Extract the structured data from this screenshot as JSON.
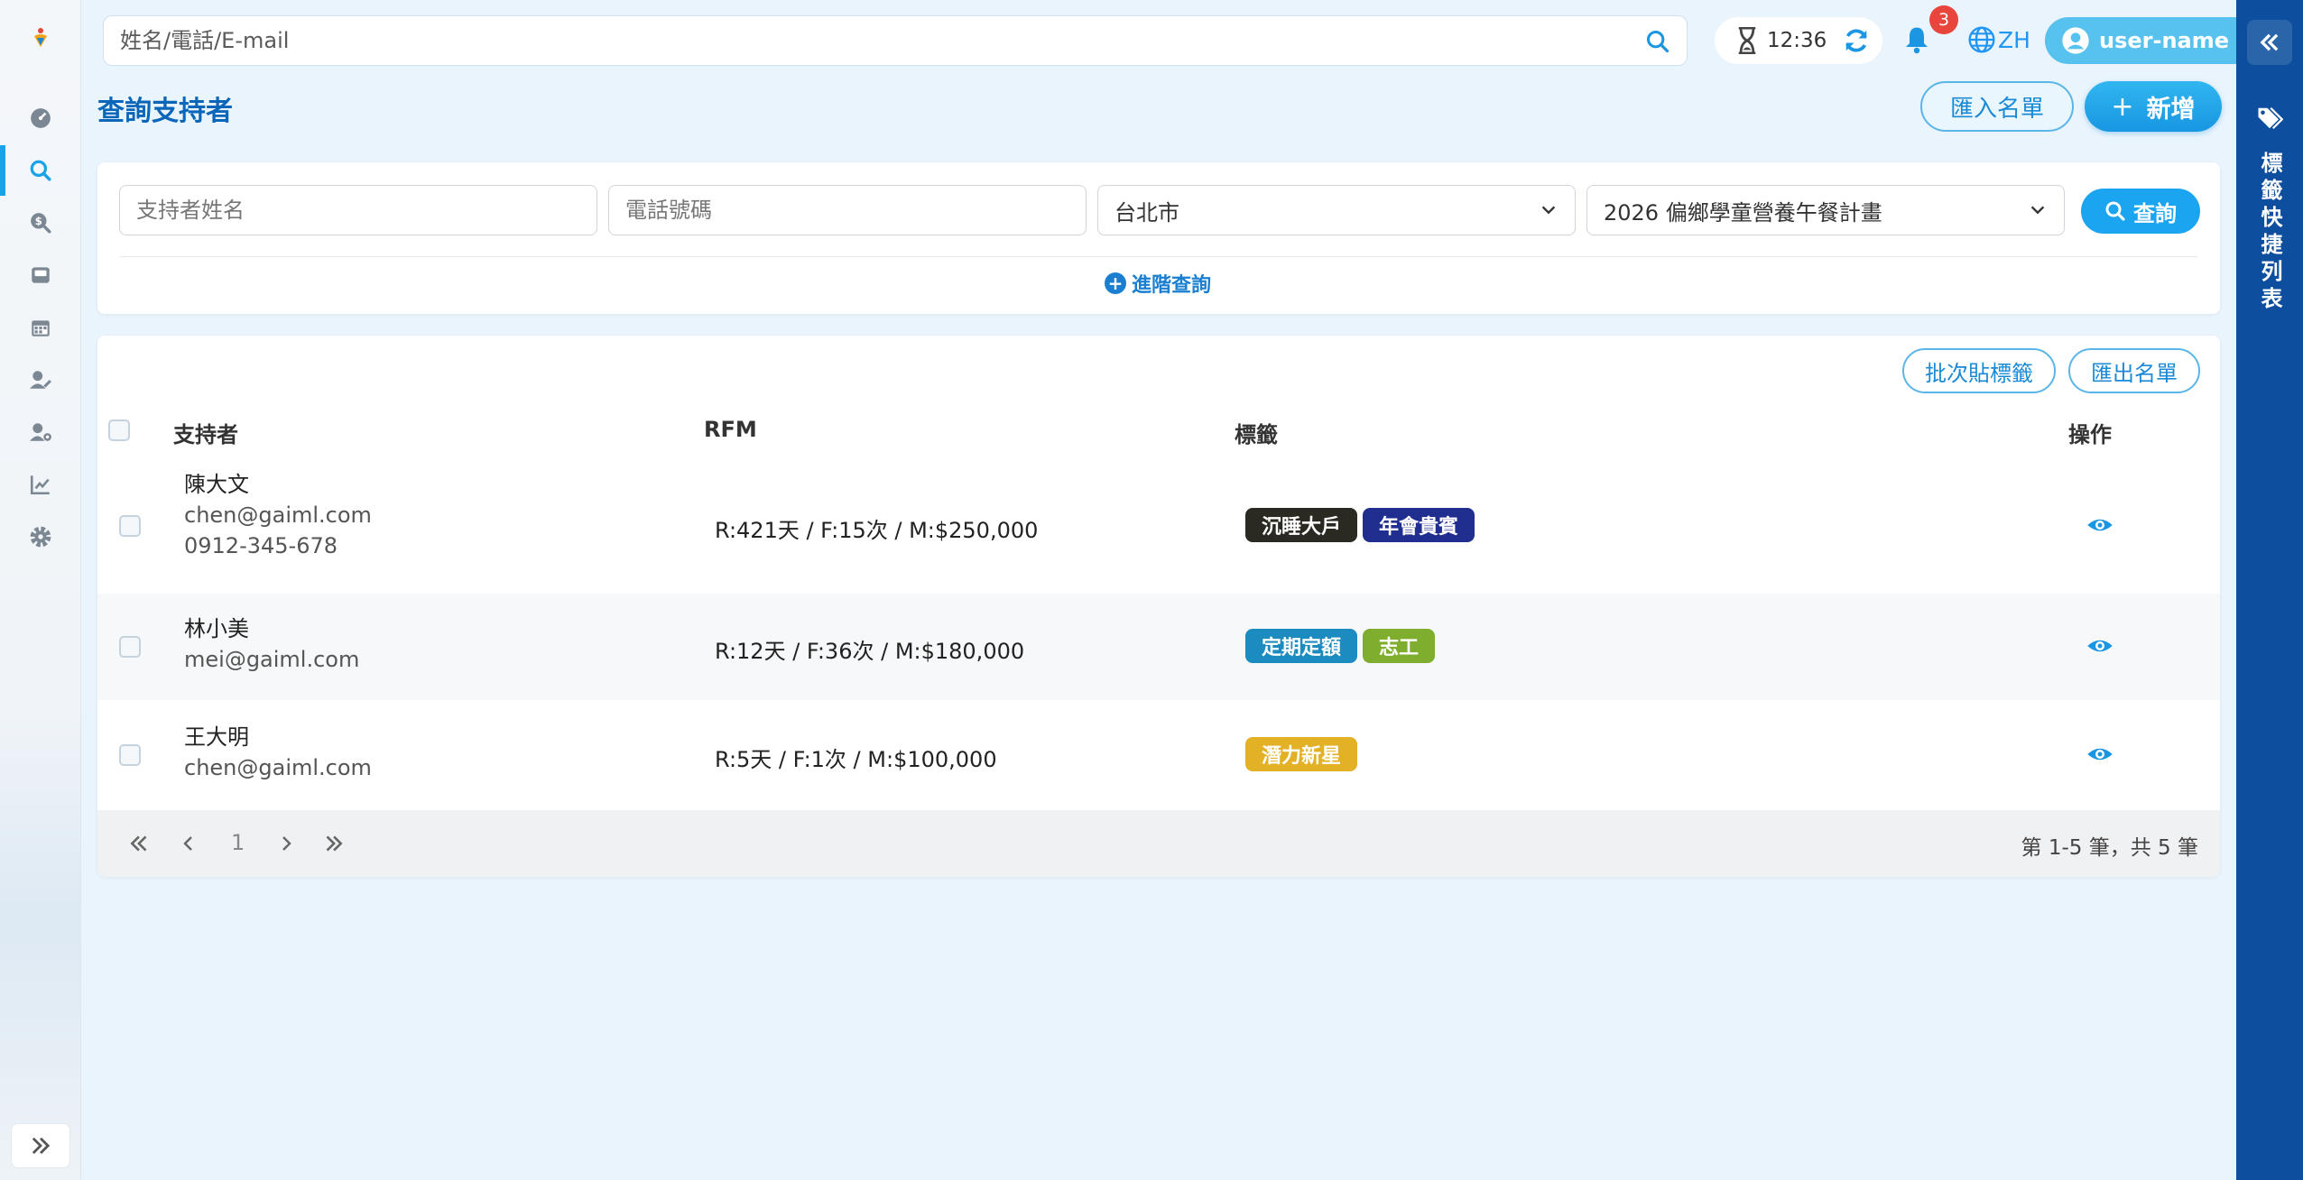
{
  "topbar": {
    "search_placeholder": "姓名/電話/E-mail",
    "timer": "12:36",
    "notification_count": "3",
    "language": "ZH",
    "username": "user-name"
  },
  "sidebar": {
    "items": [
      {
        "icon": "dashboard-icon"
      },
      {
        "icon": "search-icon",
        "active": true
      },
      {
        "icon": "donation-search-icon"
      },
      {
        "icon": "inbox-icon"
      },
      {
        "icon": "calendar-icon"
      },
      {
        "icon": "user-edit-icon"
      },
      {
        "icon": "user-settings-icon"
      },
      {
        "icon": "chart-line-icon"
      },
      {
        "icon": "settings-icon"
      }
    ]
  },
  "rightpanel": {
    "title": "標籤快捷列表"
  },
  "page": {
    "title": "查詢支持者",
    "import_label": "匯入名單",
    "add_label": "新增"
  },
  "filters": {
    "name_placeholder": "支持者姓名",
    "phone_placeholder": "電話號碼",
    "city": "台北市",
    "project": "2026 偏鄉學童營養午餐計畫",
    "query_label": "查詢",
    "advanced_label": "進階查詢"
  },
  "table": {
    "batch_tag_label": "批次貼標籤",
    "export_label": "匯出名單",
    "headers": {
      "supporter": "支持者",
      "rfm": "RFM",
      "tags": "標籤",
      "actions": "操作"
    },
    "rows": [
      {
        "name": "陳大文",
        "email": "chen@gaiml.com",
        "phone": "0912-345-678",
        "rfm": "R:421天 / F:15次 / M:$250,000",
        "tags": [
          {
            "label": "沉睡大戶",
            "color": "#2a2a22"
          },
          {
            "label": "年會貴賓",
            "color": "#1f2e8f"
          }
        ]
      },
      {
        "name": "林小美",
        "email": "mei@gaiml.com",
        "rfm": "R:12天 / F:36次 / M:$180,000",
        "tags": [
          {
            "label": "定期定額",
            "color": "#1c8bbf"
          },
          {
            "label": "志工",
            "color": "#7fae2e"
          }
        ]
      },
      {
        "name": "王大明",
        "email": "chen@gaiml.com",
        "rfm": "R:5天 / F:1次 / M:$100,000",
        "tags": [
          {
            "label": "潛力新星",
            "color": "#e3b126"
          }
        ]
      }
    ],
    "pagination": {
      "current_page": "1",
      "summary": "第 1-5 筆，共 5 筆"
    }
  }
}
